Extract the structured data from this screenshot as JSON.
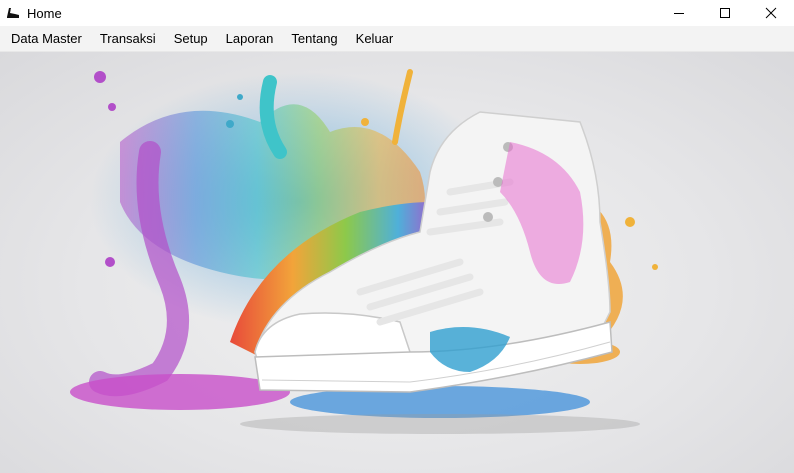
{
  "window": {
    "title": "Home",
    "app_icon": "sneaker-logo-icon",
    "controls": [
      "minimize-icon",
      "maximize-icon",
      "close-icon"
    ]
  },
  "menubar": {
    "items": [
      "Data Master",
      "Transaksi",
      "Setup",
      "Laporan",
      "Tentang",
      "Keluar"
    ]
  },
  "content": {
    "background_image": "sneaker-paint-splash-image"
  }
}
